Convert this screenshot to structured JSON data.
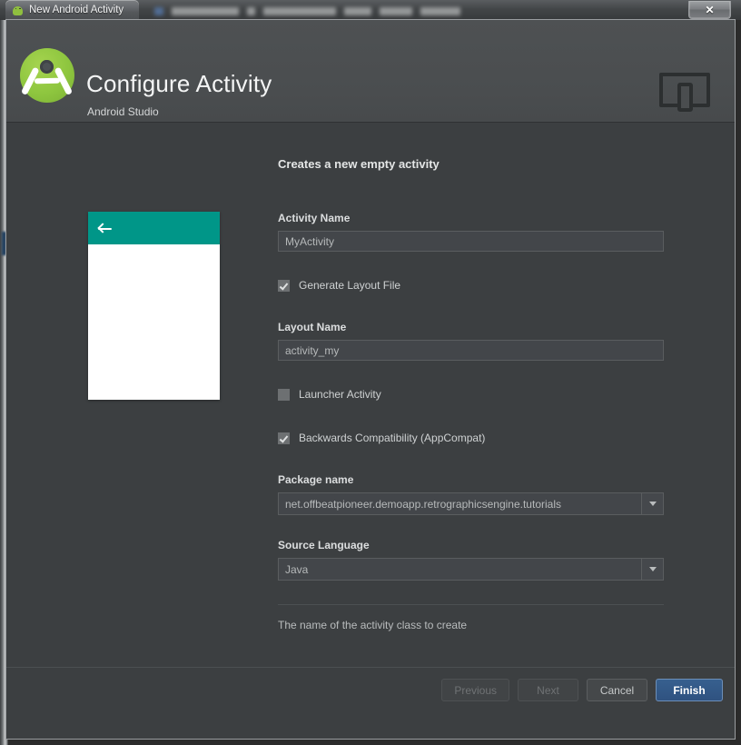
{
  "window": {
    "title": "New Android Activity",
    "close_label": "✕",
    "app_icon": "android-robot-icon"
  },
  "banner": {
    "title": "Configure Activity",
    "subtitle": "Android Studio",
    "logo_icon": "android-studio-logo-icon",
    "device_icon": "device-preview-icon"
  },
  "main": {
    "section_title": "Creates a new empty activity",
    "preview": {
      "back_icon": "back-arrow-icon",
      "appbar_color": "#009688",
      "content_color": "#ffffff"
    },
    "fields": {
      "activity_name": {
        "label": "Activity Name",
        "value": "MyActivity"
      },
      "generate_layout": {
        "label": "Generate Layout File",
        "checked": true
      },
      "layout_name": {
        "label": "Layout Name",
        "value": "activity_my"
      },
      "launcher_activity": {
        "label": "Launcher Activity",
        "checked": false
      },
      "backwards_compat": {
        "label": "Backwards Compatibility (AppCompat)",
        "checked": true
      },
      "package_name": {
        "label": "Package name",
        "value": "net.offbeatpioneer.demoapp.retrographicsengine.tutorials"
      },
      "source_language": {
        "label": "Source Language",
        "value": "Java"
      }
    },
    "help_text": "The name of the activity class to create"
  },
  "footer": {
    "previous_label": "Previous",
    "next_label": "Next",
    "cancel_label": "Cancel",
    "finish_label": "Finish"
  },
  "colors": {
    "accent_teal": "#009688",
    "primary_button": "#2f5280",
    "window_bg": "#3c3f41",
    "banner_bg": "#4a4d4f"
  }
}
